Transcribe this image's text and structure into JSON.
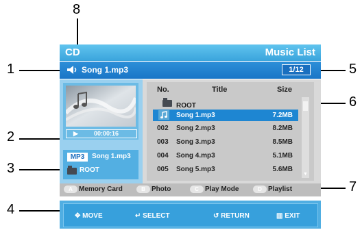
{
  "callouts": {
    "c1": "1",
    "c2": "2",
    "c3": "3",
    "c4": "4",
    "c5": "5",
    "c6": "6",
    "c7": "7",
    "c8": "8"
  },
  "titlebar": {
    "source": "CD",
    "title": "Music List"
  },
  "nowplaying": {
    "song": "Song 1.mp3",
    "counter": "1/12"
  },
  "player": {
    "time": "00:00:16",
    "format": "MP3",
    "song": "Song 1.mp3",
    "folder": "ROOT"
  },
  "list": {
    "headers": {
      "no": "No.",
      "title": "Title",
      "size": "Size"
    },
    "root_label": "ROOT",
    "rows": [
      {
        "no": "",
        "title": "Song 1.mp3",
        "size": "7.2MB",
        "selected": true
      },
      {
        "no": "002",
        "title": "Song 2.mp3",
        "size": "8.2MB"
      },
      {
        "no": "003",
        "title": "Song 3.mp3",
        "size": "8.5MB"
      },
      {
        "no": "004",
        "title": "Song 4.mp3",
        "size": "5.1MB"
      },
      {
        "no": "005",
        "title": "Song 5.mp3",
        "size": "5.6MB"
      }
    ]
  },
  "colorbuttons": [
    {
      "key": "A",
      "label": "Memory Card"
    },
    {
      "key": "B",
      "label": "Photo"
    },
    {
      "key": "C",
      "label": "Play Mode"
    },
    {
      "key": "D",
      "label": "Playlist"
    }
  ],
  "nav": {
    "move": "MOVE",
    "select": "SELECT",
    "return": "RETURN",
    "exit": "EXIT"
  },
  "colors": {
    "accent": "#1e86d2",
    "titlebar": "#3aa4dc",
    "panel": "#9ad0ef"
  }
}
